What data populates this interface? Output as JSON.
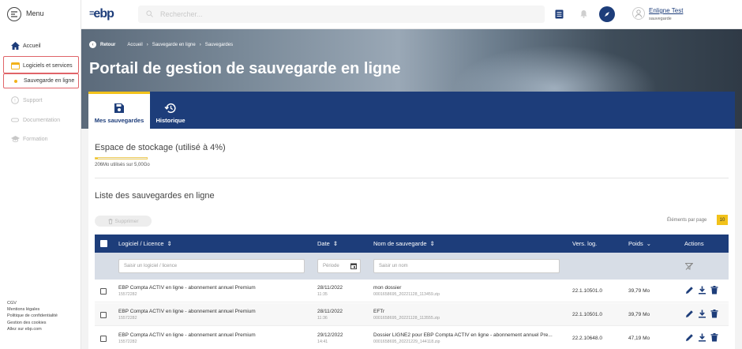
{
  "sidebar": {
    "menu_label": "Menu",
    "items": [
      {
        "label": "Accueil",
        "icon": "home-icon"
      },
      {
        "label": "Logiciels et services",
        "icon": "calendar-icon"
      },
      {
        "label": "Sauvegarde en ligne",
        "icon": "dot-icon"
      },
      {
        "label": "Support",
        "icon": "help-icon"
      },
      {
        "label": "Documentation",
        "icon": "book-icon"
      },
      {
        "label": "Formation",
        "icon": "graduation-cap-icon"
      }
    ],
    "footer_links": [
      "CGV",
      "Mentions légales",
      "Politique de confidentialité",
      "Gestion des cookies",
      "Allez sur ebp.com"
    ]
  },
  "header": {
    "logo": "ebp",
    "search_placeholder": "Rechercher...",
    "user_name": "Enligne Test",
    "user_sub": "sauvegarde"
  },
  "hero": {
    "back": "Retour",
    "crumbs": [
      "Accueil",
      "Sauvegarde en ligne",
      "Sauvegardes"
    ],
    "title": "Portail de gestion de sauvegarde en ligne"
  },
  "tabs": [
    {
      "label": "Mes sauvegardes",
      "icon": "save-icon",
      "active": true
    },
    {
      "label": "Historique",
      "icon": "history-icon",
      "active": false
    }
  ],
  "storage": {
    "title": "Espace de stockage (utilisé à 4%)",
    "used_text": "206Mo utilisés sur 5,00Go",
    "used_fraction": 0.04
  },
  "list": {
    "title": "Liste des sauvegardes en ligne",
    "delete_label": "Supprimer",
    "per_page_label": "Éléments par page",
    "per_page_value": "10",
    "columns": {
      "software": "Logiciel / Licence",
      "date": "Date",
      "name": "Nom de sauvegarde",
      "version": "Vers. log.",
      "size": "Poids",
      "actions": "Actions"
    },
    "filters": {
      "software_placeholder": "Saisir un logiciel / licence",
      "date_placeholder": "Période",
      "name_placeholder": "Saisir un nom"
    },
    "rows": [
      {
        "software": "EBP Compta ACTIV en ligne - abonnement annuel Premium",
        "license": "15572282",
        "date": "28/11/2022",
        "time": "11:35",
        "name": "mon dossier",
        "file": "0001658695_20221128_113459.zip",
        "version": "22.1.10501.0",
        "size": "39,79 Mo"
      },
      {
        "software": "EBP Compta ACTIV en ligne - abonnement annuel Premium",
        "license": "15572282",
        "date": "28/11/2022",
        "time": "11:36",
        "name": "EFTr",
        "file": "0001658695_20221128_113555.zip",
        "version": "22.1.10501.0",
        "size": "39,79 Mo"
      },
      {
        "software": "EBP Compta ACTIV en ligne - abonnement annuel Premium",
        "license": "15572282",
        "date": "29/12/2022",
        "time": "14:41",
        "name": "Dossier LIGNE2 pour EBP Compta ACTIV en ligne - abonnement annuel Pre...",
        "file": "0001658695_20221229_144118.zip",
        "version": "22.2.10648.0",
        "size": "47,19 Mo"
      }
    ]
  },
  "colors": {
    "brand": "#1d3d7a",
    "accent": "#f2c21a",
    "highlight": "#e06469"
  }
}
